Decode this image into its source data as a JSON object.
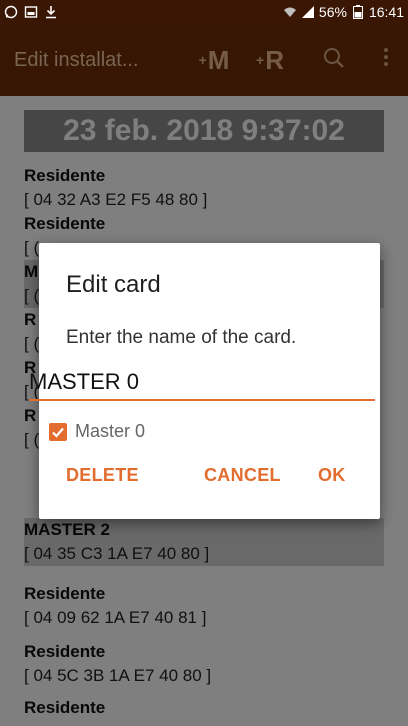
{
  "status_bar": {
    "battery": "56%",
    "time": "16:41",
    "icons_left": [
      "whatsapp-icon",
      "screenshot-icon",
      "download-icon"
    ],
    "icons_right": [
      "wifi-icon",
      "signal-icon",
      "battery-icon"
    ]
  },
  "app_bar": {
    "title": "Edit installat...",
    "m_label": "M",
    "r_label": "R",
    "actions": [
      "master-action",
      "residente-action",
      "search-icon",
      "overflow-menu-icon"
    ]
  },
  "list": {
    "date": "23 feb. 2018 9:37:02",
    "items": [
      {
        "name": "Residente",
        "uid": "[ 04 32 A3 E2 F5 48 80 ]"
      },
      {
        "name": "Residente",
        "uid": "[ ("
      },
      {
        "name": "M",
        "uid": "[ ("
      },
      {
        "name": "R",
        "uid": "[ ("
      },
      {
        "name": "R",
        "uid": "[ ("
      },
      {
        "name": "R",
        "uid": "[ ("
      },
      {
        "name": "MASTER 2",
        "uid": "[ 04 35 C3 1A E7 40 80 ]"
      },
      {
        "name": "Residente",
        "uid": "[ 04 09 62 1A E7 40 81 ]"
      },
      {
        "name": "Residente",
        "uid": "[ 04 5C 3B 1A E7 40 80 ]"
      },
      {
        "name": "Residente",
        "uid": ""
      }
    ]
  },
  "dialog": {
    "title": "Edit card",
    "message": "Enter the name of the card.",
    "input_value": "MASTER 0",
    "checkbox_label": "Master 0",
    "checkbox_checked": true,
    "delete_label": "DELETE",
    "cancel_label": "CANCEL",
    "ok_label": "OK"
  },
  "colors": {
    "accent": "#e26d2f",
    "appbar": "#6e2e08",
    "statusbar": "#3a1604"
  }
}
